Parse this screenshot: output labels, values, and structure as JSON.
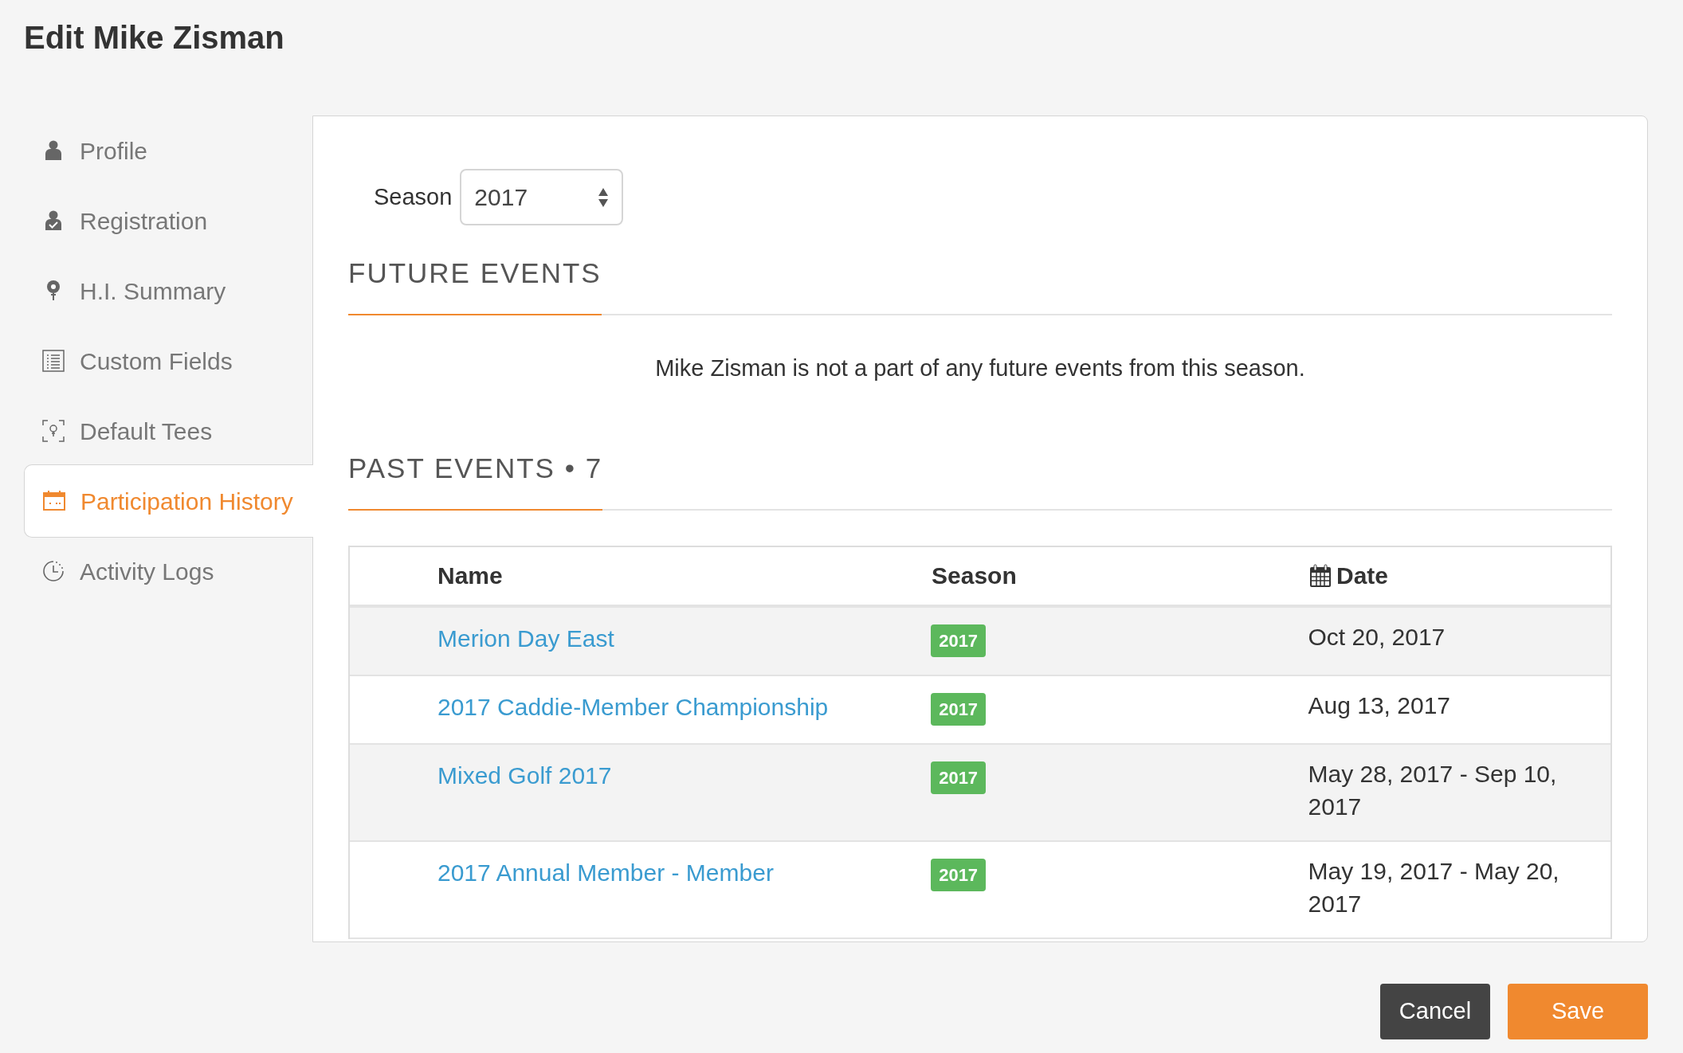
{
  "page_title": "Edit Mike Zisman",
  "sidebar": {
    "items": [
      {
        "label": "Profile",
        "kind": "person",
        "selected": false
      },
      {
        "label": "Registration",
        "kind": "person-check",
        "selected": false
      },
      {
        "label": "H.I. Summary",
        "kind": "pin",
        "selected": false
      },
      {
        "label": "Custom Fields",
        "kind": "list",
        "selected": false
      },
      {
        "label": "Default Tees",
        "kind": "tee",
        "selected": false
      },
      {
        "label": "Participation History",
        "kind": "calendar",
        "selected": true
      },
      {
        "label": "Activity Logs",
        "kind": "clock",
        "selected": false
      }
    ]
  },
  "season_filter": {
    "label": "Season",
    "value": "2017"
  },
  "future_events": {
    "heading": "FUTURE EVENTS",
    "message": "Mike Zisman is not a part of any future events from this season."
  },
  "past_events": {
    "heading": "PAST EVENTS • 7",
    "table": {
      "columns": [
        "Name",
        "Season",
        "Date"
      ],
      "rows": [
        {
          "name": "Merion Day East",
          "season": "2017",
          "date": "Oct 20, 2017"
        },
        {
          "name": "2017 Caddie-Member Championship",
          "season": "2017",
          "date": "Aug 13, 2017"
        },
        {
          "name": "Mixed Golf 2017",
          "season": "2017",
          "date": "May 28, 2017 - Sep 10, 2017"
        },
        {
          "name": "2017 Annual Member - Member",
          "season": "2017",
          "date": "May 19, 2017 - May 20, 2017"
        }
      ]
    }
  },
  "buttons": {
    "cancel": "Cancel",
    "save": "Save"
  }
}
